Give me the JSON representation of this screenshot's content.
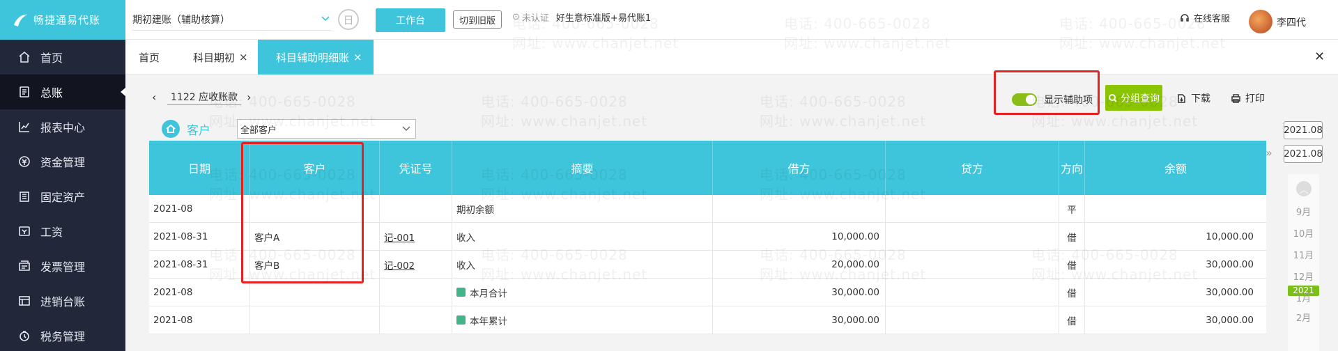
{
  "brand": {
    "name": "畅捷通易代账"
  },
  "sidebar": {
    "items": [
      {
        "label": "首页",
        "icon": "home-icon"
      },
      {
        "label": "总账",
        "icon": "ledger-icon",
        "active": true
      },
      {
        "label": "报表中心",
        "icon": "chart-icon"
      },
      {
        "label": "资金管理",
        "icon": "money-icon"
      },
      {
        "label": "固定资产",
        "icon": "asset-icon"
      },
      {
        "label": "工资",
        "icon": "salary-icon"
      },
      {
        "label": "发票管理",
        "icon": "invoice-icon"
      },
      {
        "label": "进销台账",
        "icon": "inventory-icon"
      },
      {
        "label": "税务管理",
        "icon": "tax-icon"
      }
    ]
  },
  "topbar": {
    "account_select": "期初建账（辅助核算）",
    "calendar_glyph": "日",
    "workbench": "工作台",
    "old_version": "切到旧版",
    "cert_status": "未认证",
    "company": "好生意标准版+易代账1",
    "service": "在线客服",
    "user": "李四代"
  },
  "tabs": [
    {
      "label": "首页",
      "closable": false
    },
    {
      "label": "科目期初",
      "closable": true
    },
    {
      "label": "科目辅助明细账",
      "closable": true,
      "active": true
    }
  ],
  "close_all": "✕",
  "toolbar": {
    "prev": "‹",
    "next": "›",
    "account": "1122  应收账款",
    "filter_label": "客户",
    "customer_select": "全部客户",
    "toggle_label": "显示辅助项",
    "group_query": "分组查询",
    "download": "下载",
    "print": "打印"
  },
  "table": {
    "headers": [
      "日期",
      "客户",
      "凭证号",
      "摘要",
      "借方",
      "贷方",
      "方向",
      "余额"
    ],
    "rows": [
      {
        "date": "2021-08",
        "customer": "",
        "voucher": "",
        "summary": "期初余额",
        "summary_icon": false,
        "debit": "",
        "credit": "",
        "direction": "平",
        "balance": ""
      },
      {
        "date": "2021-08-31",
        "customer": "客户A",
        "voucher": "记-001",
        "summary": "收入",
        "summary_icon": false,
        "debit": "10,000.00",
        "credit": "",
        "direction": "借",
        "balance": "10,000.00"
      },
      {
        "date": "2021-08-31",
        "customer": "客户B",
        "voucher": "记-002",
        "summary": "收入",
        "summary_icon": false,
        "debit": "20,000.00",
        "credit": "",
        "direction": "借",
        "balance": "30,000.00"
      },
      {
        "date": "2021-08",
        "customer": "",
        "voucher": "",
        "summary": "本月合计",
        "summary_icon": true,
        "debit": "30,000.00",
        "credit": "",
        "direction": "借",
        "balance": "30,000.00"
      },
      {
        "date": "2021-08",
        "customer": "",
        "voucher": "",
        "summary": "本年累计",
        "summary_icon": true,
        "debit": "30,000.00",
        "credit": "",
        "direction": "借",
        "balance": "30,000.00"
      }
    ]
  },
  "date_panel": {
    "expand": "»",
    "from": "2021.08",
    "to": "2021.08",
    "up": "︿",
    "months": [
      "9月",
      "10月",
      "11月",
      "12月",
      "1月",
      "2月"
    ],
    "year": "2021"
  },
  "watermark": {
    "phone": "电话: 400-665-0028",
    "site": "网址: www.chanjet.net"
  },
  "colors": {
    "accent": "#3ec5db",
    "sidebar": "#23273a",
    "green": "#8bc400",
    "highlight": "#e52020"
  }
}
